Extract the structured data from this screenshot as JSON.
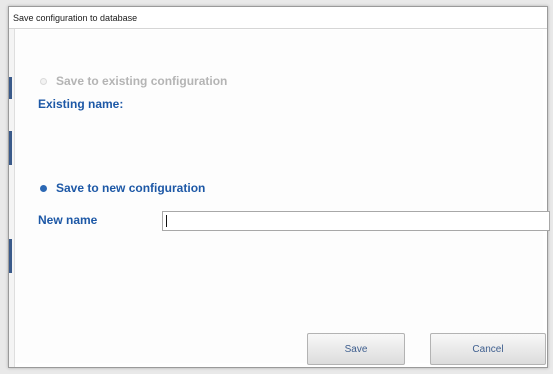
{
  "window": {
    "title": "Save configuration to database"
  },
  "existing": {
    "radio_label": "Save to existing configuration",
    "name_label": "Existing name:",
    "enabled": false
  },
  "new_config": {
    "radio_label": "Save to new configuration",
    "name_label": "New name",
    "name_value": "",
    "selected": true
  },
  "buttons": {
    "save_label": "Save",
    "cancel_label": "Cancel"
  },
  "colors": {
    "label_blue": "#1d58a6",
    "disabled_gray": "#b4b4b4"
  }
}
